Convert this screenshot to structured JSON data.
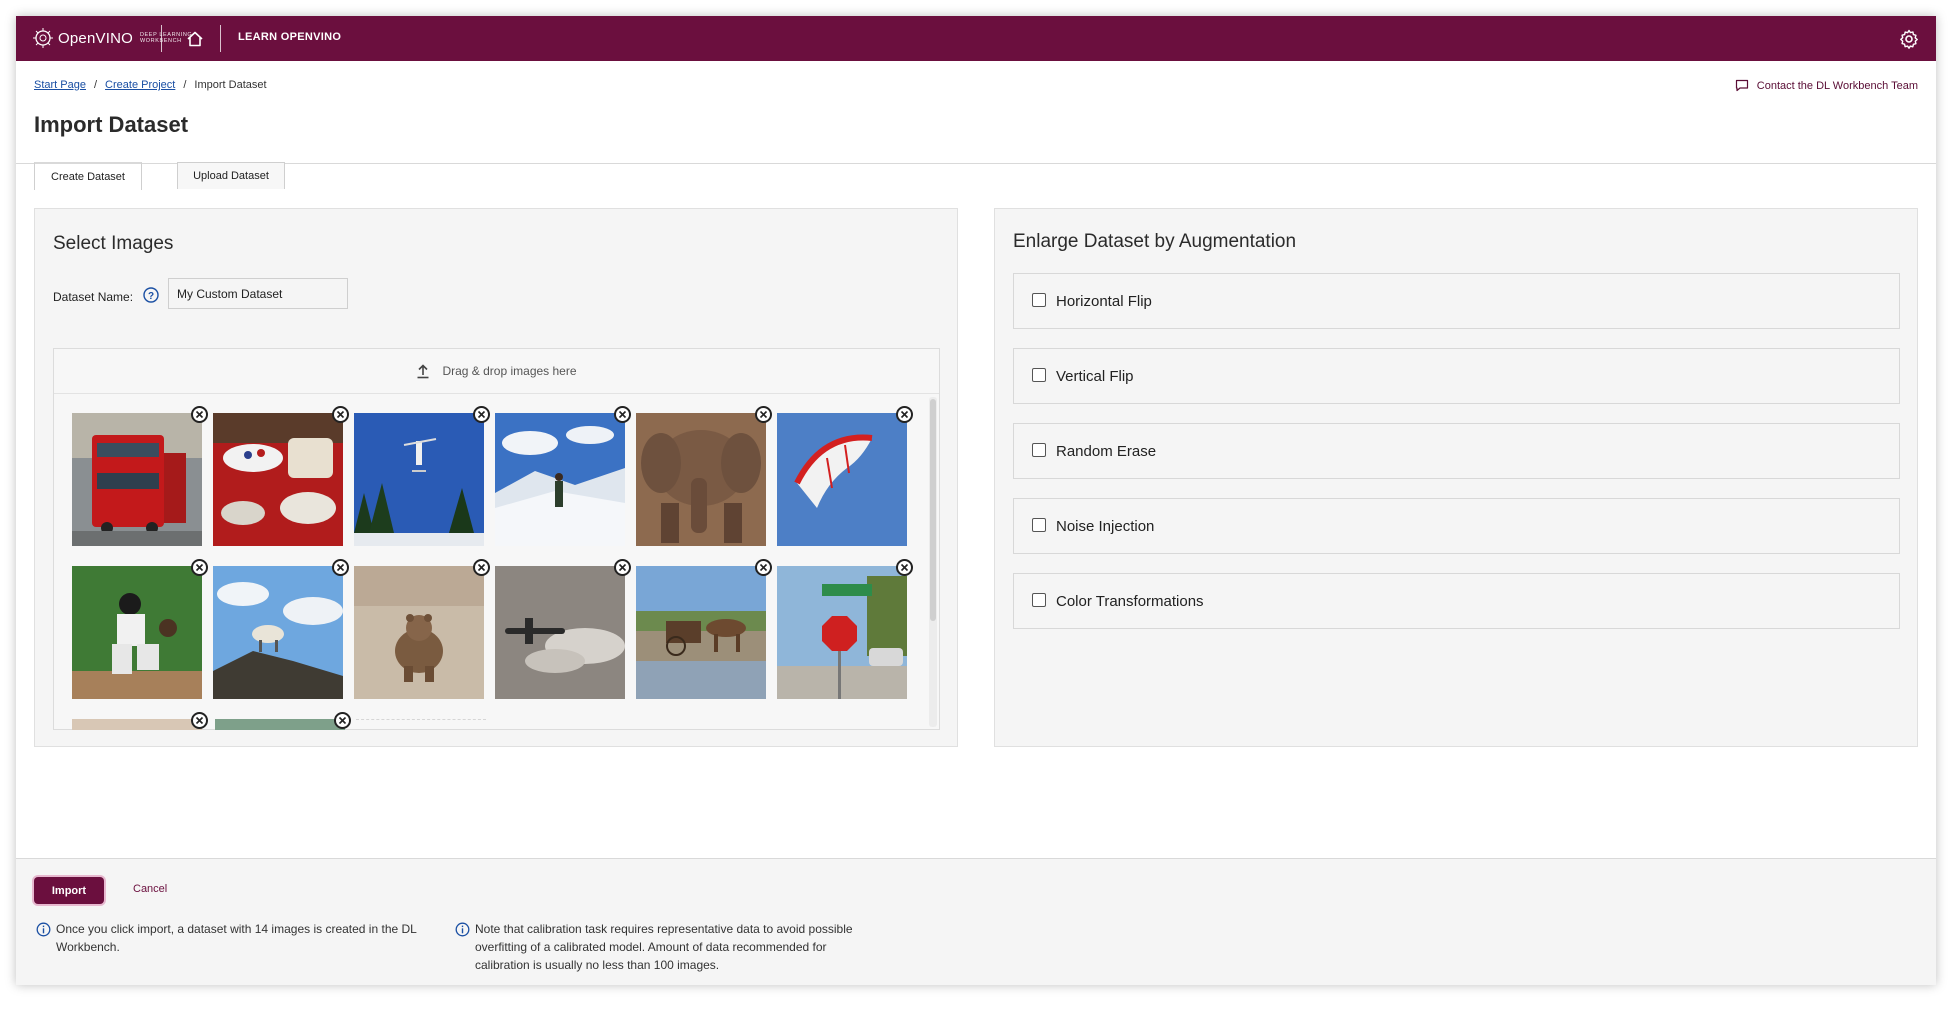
{
  "topbar": {
    "logo_text": "OpenVINO",
    "logo_sub_line1": "Deep Learning",
    "logo_sub_line2": "Workbench",
    "learn_label": "LEARN OPENVINO"
  },
  "breadcrumb": {
    "items": [
      "Start Page",
      "Create Project",
      "Import Dataset"
    ],
    "separator": "/"
  },
  "contact_label": "Contact the DL Workbench Team",
  "page_title": "Import Dataset",
  "tabs": [
    {
      "label": "Create Dataset",
      "active": true
    },
    {
      "label": "Upload Dataset",
      "active": false
    }
  ],
  "select_images": {
    "title": "Select Images",
    "dataset_name_label": "Dataset Name:",
    "dataset_name_value": "My Custom Dataset",
    "dropzone_label": "Drag & drop images here",
    "images": [
      "red-bus",
      "cake-table",
      "skier-jump",
      "snow-hiker",
      "elephant",
      "kite",
      "baseball-catcher",
      "sheep-on-rock",
      "bear",
      "airplane",
      "horse-carriage",
      "stop-sign",
      "partial-image-13",
      "partial-image-14"
    ]
  },
  "augmentation": {
    "title": "Enlarge Dataset by Augmentation",
    "options": [
      {
        "label": "Horizontal Flip",
        "checked": false
      },
      {
        "label": "Vertical Flip",
        "checked": false
      },
      {
        "label": "Random Erase",
        "checked": false
      },
      {
        "label": "Noise Injection",
        "checked": false
      },
      {
        "label": "Color Transformations",
        "checked": false
      }
    ]
  },
  "footer": {
    "import_label": "Import",
    "cancel_label": "Cancel",
    "note1": "Once you click import, a dataset with 14 images is created in the DL Workbench.",
    "note2": "Note that calibration task requires representative data to avoid possible overfitting of a calibrated model. Amount of data recommended for calibration is usually no less than 100 images."
  },
  "colors": {
    "brand": "#6b0f3e",
    "link": "#1a4fa3",
    "panel_bg": "#f5f5f5"
  }
}
